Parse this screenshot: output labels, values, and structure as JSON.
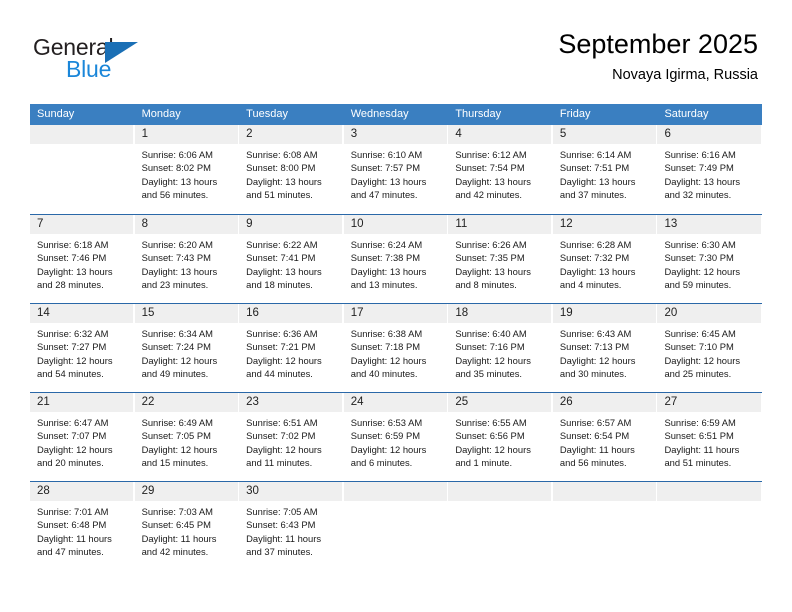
{
  "brand": {
    "line1": "General",
    "line2": "Blue",
    "triangle_color": "#1a6fb5",
    "blue_color": "#1a86d9"
  },
  "header": {
    "title": "September 2025",
    "subtitle": "Novaya Igirma, Russia"
  },
  "theme": {
    "header_row_bg": "#3a7fc1",
    "week_divider": "#2a68a8",
    "date_band_bg": "#efefef",
    "text": "#1a1a1a"
  },
  "weekdays": [
    "Sunday",
    "Monday",
    "Tuesday",
    "Wednesday",
    "Thursday",
    "Friday",
    "Saturday"
  ],
  "weeks": [
    [
      {
        "day": "",
        "sunrise": "",
        "sunset": "",
        "daylight1": "",
        "daylight2": ""
      },
      {
        "day": "1",
        "sunrise": "Sunrise: 6:06 AM",
        "sunset": "Sunset: 8:02 PM",
        "daylight1": "Daylight: 13 hours",
        "daylight2": "and 56 minutes."
      },
      {
        "day": "2",
        "sunrise": "Sunrise: 6:08 AM",
        "sunset": "Sunset: 8:00 PM",
        "daylight1": "Daylight: 13 hours",
        "daylight2": "and 51 minutes."
      },
      {
        "day": "3",
        "sunrise": "Sunrise: 6:10 AM",
        "sunset": "Sunset: 7:57 PM",
        "daylight1": "Daylight: 13 hours",
        "daylight2": "and 47 minutes."
      },
      {
        "day": "4",
        "sunrise": "Sunrise: 6:12 AM",
        "sunset": "Sunset: 7:54 PM",
        "daylight1": "Daylight: 13 hours",
        "daylight2": "and 42 minutes."
      },
      {
        "day": "5",
        "sunrise": "Sunrise: 6:14 AM",
        "sunset": "Sunset: 7:51 PM",
        "daylight1": "Daylight: 13 hours",
        "daylight2": "and 37 minutes."
      },
      {
        "day": "6",
        "sunrise": "Sunrise: 6:16 AM",
        "sunset": "Sunset: 7:49 PM",
        "daylight1": "Daylight: 13 hours",
        "daylight2": "and 32 minutes."
      }
    ],
    [
      {
        "day": "7",
        "sunrise": "Sunrise: 6:18 AM",
        "sunset": "Sunset: 7:46 PM",
        "daylight1": "Daylight: 13 hours",
        "daylight2": "and 28 minutes."
      },
      {
        "day": "8",
        "sunrise": "Sunrise: 6:20 AM",
        "sunset": "Sunset: 7:43 PM",
        "daylight1": "Daylight: 13 hours",
        "daylight2": "and 23 minutes."
      },
      {
        "day": "9",
        "sunrise": "Sunrise: 6:22 AM",
        "sunset": "Sunset: 7:41 PM",
        "daylight1": "Daylight: 13 hours",
        "daylight2": "and 18 minutes."
      },
      {
        "day": "10",
        "sunrise": "Sunrise: 6:24 AM",
        "sunset": "Sunset: 7:38 PM",
        "daylight1": "Daylight: 13 hours",
        "daylight2": "and 13 minutes."
      },
      {
        "day": "11",
        "sunrise": "Sunrise: 6:26 AM",
        "sunset": "Sunset: 7:35 PM",
        "daylight1": "Daylight: 13 hours",
        "daylight2": "and 8 minutes."
      },
      {
        "day": "12",
        "sunrise": "Sunrise: 6:28 AM",
        "sunset": "Sunset: 7:32 PM",
        "daylight1": "Daylight: 13 hours",
        "daylight2": "and 4 minutes."
      },
      {
        "day": "13",
        "sunrise": "Sunrise: 6:30 AM",
        "sunset": "Sunset: 7:30 PM",
        "daylight1": "Daylight: 12 hours",
        "daylight2": "and 59 minutes."
      }
    ],
    [
      {
        "day": "14",
        "sunrise": "Sunrise: 6:32 AM",
        "sunset": "Sunset: 7:27 PM",
        "daylight1": "Daylight: 12 hours",
        "daylight2": "and 54 minutes."
      },
      {
        "day": "15",
        "sunrise": "Sunrise: 6:34 AM",
        "sunset": "Sunset: 7:24 PM",
        "daylight1": "Daylight: 12 hours",
        "daylight2": "and 49 minutes."
      },
      {
        "day": "16",
        "sunrise": "Sunrise: 6:36 AM",
        "sunset": "Sunset: 7:21 PM",
        "daylight1": "Daylight: 12 hours",
        "daylight2": "and 44 minutes."
      },
      {
        "day": "17",
        "sunrise": "Sunrise: 6:38 AM",
        "sunset": "Sunset: 7:18 PM",
        "daylight1": "Daylight: 12 hours",
        "daylight2": "and 40 minutes."
      },
      {
        "day": "18",
        "sunrise": "Sunrise: 6:40 AM",
        "sunset": "Sunset: 7:16 PM",
        "daylight1": "Daylight: 12 hours",
        "daylight2": "and 35 minutes."
      },
      {
        "day": "19",
        "sunrise": "Sunrise: 6:43 AM",
        "sunset": "Sunset: 7:13 PM",
        "daylight1": "Daylight: 12 hours",
        "daylight2": "and 30 minutes."
      },
      {
        "day": "20",
        "sunrise": "Sunrise: 6:45 AM",
        "sunset": "Sunset: 7:10 PM",
        "daylight1": "Daylight: 12 hours",
        "daylight2": "and 25 minutes."
      }
    ],
    [
      {
        "day": "21",
        "sunrise": "Sunrise: 6:47 AM",
        "sunset": "Sunset: 7:07 PM",
        "daylight1": "Daylight: 12 hours",
        "daylight2": "and 20 minutes."
      },
      {
        "day": "22",
        "sunrise": "Sunrise: 6:49 AM",
        "sunset": "Sunset: 7:05 PM",
        "daylight1": "Daylight: 12 hours",
        "daylight2": "and 15 minutes."
      },
      {
        "day": "23",
        "sunrise": "Sunrise: 6:51 AM",
        "sunset": "Sunset: 7:02 PM",
        "daylight1": "Daylight: 12 hours",
        "daylight2": "and 11 minutes."
      },
      {
        "day": "24",
        "sunrise": "Sunrise: 6:53 AM",
        "sunset": "Sunset: 6:59 PM",
        "daylight1": "Daylight: 12 hours",
        "daylight2": "and 6 minutes."
      },
      {
        "day": "25",
        "sunrise": "Sunrise: 6:55 AM",
        "sunset": "Sunset: 6:56 PM",
        "daylight1": "Daylight: 12 hours",
        "daylight2": "and 1 minute."
      },
      {
        "day": "26",
        "sunrise": "Sunrise: 6:57 AM",
        "sunset": "Sunset: 6:54 PM",
        "daylight1": "Daylight: 11 hours",
        "daylight2": "and 56 minutes."
      },
      {
        "day": "27",
        "sunrise": "Sunrise: 6:59 AM",
        "sunset": "Sunset: 6:51 PM",
        "daylight1": "Daylight: 11 hours",
        "daylight2": "and 51 minutes."
      }
    ],
    [
      {
        "day": "28",
        "sunrise": "Sunrise: 7:01 AM",
        "sunset": "Sunset: 6:48 PM",
        "daylight1": "Daylight: 11 hours",
        "daylight2": "and 47 minutes."
      },
      {
        "day": "29",
        "sunrise": "Sunrise: 7:03 AM",
        "sunset": "Sunset: 6:45 PM",
        "daylight1": "Daylight: 11 hours",
        "daylight2": "and 42 minutes."
      },
      {
        "day": "30",
        "sunrise": "Sunrise: 7:05 AM",
        "sunset": "Sunset: 6:43 PM",
        "daylight1": "Daylight: 11 hours",
        "daylight2": "and 37 minutes."
      },
      {
        "day": "",
        "sunrise": "",
        "sunset": "",
        "daylight1": "",
        "daylight2": ""
      },
      {
        "day": "",
        "sunrise": "",
        "sunset": "",
        "daylight1": "",
        "daylight2": ""
      },
      {
        "day": "",
        "sunrise": "",
        "sunset": "",
        "daylight1": "",
        "daylight2": ""
      },
      {
        "day": "",
        "sunrise": "",
        "sunset": "",
        "daylight1": "",
        "daylight2": ""
      }
    ]
  ]
}
